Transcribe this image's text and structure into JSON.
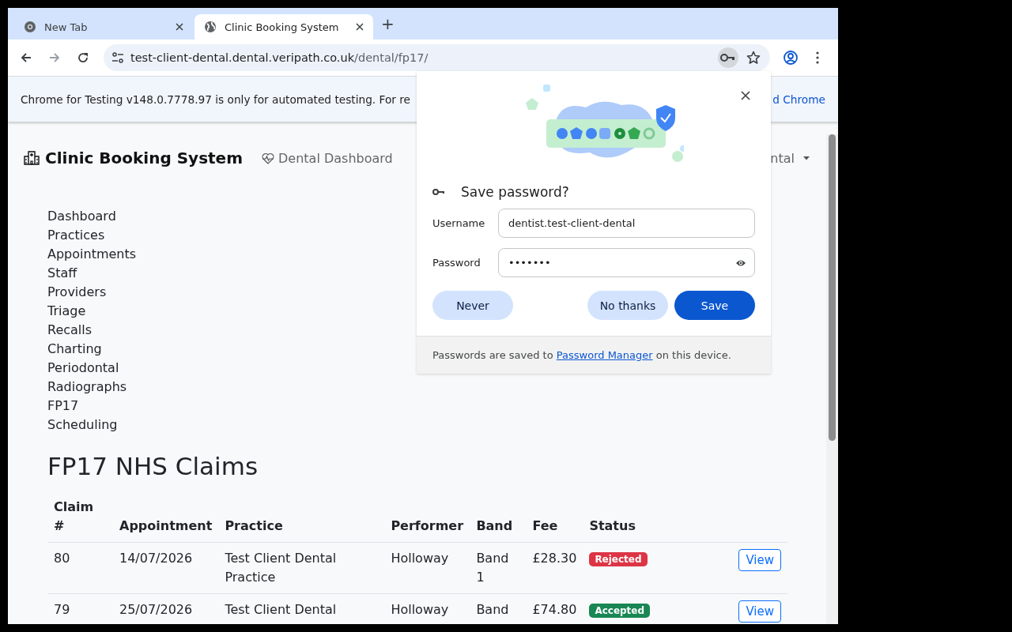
{
  "browser": {
    "tabs": [
      {
        "title": "New Tab",
        "kind": "newtab",
        "selected": false
      },
      {
        "title": "Clinic Booking System",
        "kind": "site",
        "selected": true
      }
    ],
    "new_tab_button": "+",
    "url": {
      "host": "test-client-dental.dental.veripath.co.uk",
      "path": "/dental/fp17/"
    }
  },
  "infobar": {
    "message": "Chrome for Testing v148.0.7778.97 is only for automated testing. For re",
    "link": "d Chrome"
  },
  "navbar": {
    "brand": "Clinic Booking System",
    "link": "Dental Dashboard",
    "menu": "ntal"
  },
  "sidebar": {
    "items": [
      "Dashboard",
      "Practices",
      "Appointments",
      "Staff",
      "Providers",
      "Triage",
      "Recalls",
      "Charting",
      "Periodontal",
      "Radiographs",
      "FP17",
      "Scheduling"
    ]
  },
  "page": {
    "title": "FP17 NHS Claims"
  },
  "table": {
    "columns": [
      "Claim #",
      "Appointment",
      "Practice",
      "Performer",
      "Band",
      "Fee",
      "Status"
    ],
    "rows": [
      {
        "claim": "80",
        "appointment": "14/07/2026",
        "practice": "Test Client Dental Practice",
        "performer": "Holloway",
        "band": "Band 1",
        "fee": "£28.30",
        "status": {
          "label": "Rejected",
          "kind": "rejected"
        },
        "action": "View"
      },
      {
        "claim": "79",
        "appointment": "25/07/2026",
        "practice": "Test Client Dental",
        "performer": "Holloway",
        "band": "Band",
        "fee": "£74.80",
        "status": {
          "label": "Accepted",
          "kind": "accepted"
        },
        "action": "View"
      }
    ]
  },
  "password_dialog": {
    "title": "Save password?",
    "username_label": "Username",
    "username": "dentist.test-client-dental",
    "password_label": "Password",
    "password": "•••••••",
    "buttons": [
      {
        "label": "Never",
        "kind": "tonal"
      },
      {
        "label": "No thanks",
        "kind": "tonal"
      },
      {
        "label": "Save",
        "kind": "primary"
      }
    ],
    "footer": {
      "before": "Passwords are saved to ",
      "link": "Password Manager",
      "after": " on this device."
    }
  }
}
